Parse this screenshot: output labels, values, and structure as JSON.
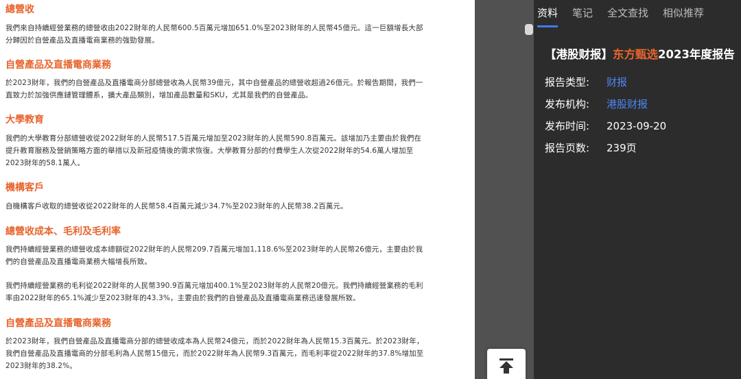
{
  "document": {
    "sections": [
      {
        "heading": "總營收",
        "paragraphs": [
          "我們來自持續經營業務的總營收由2022財年的人民幣600.5百萬元增加651.0%至2023財年的人民幣45億元。這一巨額增長大部分歸因於自營產品及直播電商業務的強勁發展。"
        ]
      },
      {
        "heading": "自營產品及直播電商業務",
        "paragraphs": [
          "於2023財年，我們的自營產品及直播電商分部總營收為人民幣39億元，其中自營產品的總營收超過26億元。於報告期間，我們一直致力於加強供應鏈管理體系，擴大產品類別，增加產品數量和SKU，尤其是我們的自營產品。"
        ]
      },
      {
        "heading": "大學教育",
        "paragraphs": [
          "我們的大學教育分部總營收從2022財年的人民幣517.5百萬元增加至2023財年的人民幣590.8百萬元。該增加乃主要由於我們在提升教育服務及營銷策略方面的舉措以及新冠疫情後的需求恢復。大學教育分部的付費學生人次從2022財年的54.6萬人增加至2023財年的58.1萬人。"
        ]
      },
      {
        "heading": "機構客戶",
        "paragraphs": [
          "自機構客戶收取的總營收從2022財年的人民幣58.4百萬元減少34.7%至2023財年的人民幣38.2百萬元。"
        ]
      },
      {
        "heading": "總營收成本、毛利及毛利率",
        "paragraphs": [
          "我們持續經營業務的總營收成本總額從2022財年的人民幣209.7百萬元增加1,118.6%至2023財年的人民幣26億元，主要由於我們的自營產品及直播電商業務大幅增長所致。",
          "我們持續經營業務的毛利從2022財年的人民幣390.9百萬元增加400.1%至2023財年的人民幣20億元。我們持續經營業務的毛利率由2022財年的65.1%減少至2023財年的43.3%，主要由於我們的自營產品及直播電商業務迅速發展所致。"
        ]
      },
      {
        "heading": "自營產品及直播電商業務",
        "paragraphs": [
          "於2023財年，我們自營產品及直播電商分部的總營收成本為人民幣24億元，而於2022財年為人民幣15.3百萬元。於2023財年，我們自營產品及直播電商的分部毛利為人民幣15億元，而於2022財年為人民幣9.3百萬元，而毛利率從2022財年的37.8%增加至2023財年的38.2%。"
        ]
      }
    ]
  },
  "tabs": [
    "资料",
    "笔记",
    "全文查找",
    "相似推荐"
  ],
  "report": {
    "title_prefix": "【港股财报】",
    "title_brand": "东方甄选",
    "title_suffix": "2023年度报告",
    "fields": [
      {
        "label": "报告类型:",
        "value": "财报"
      },
      {
        "label": "发布机构:",
        "value": "港股财报"
      },
      {
        "label": "发布时间:",
        "value": "2023-09-20"
      },
      {
        "label": "报告页数:",
        "value": "239页"
      }
    ]
  },
  "colors": {
    "heading": "#e8642c",
    "link": "#4f86f7",
    "panel_bg": "#2c2c2c",
    "gutter_bg": "#515151",
    "tab_indicator": "#3f7cf2"
  },
  "icons": {
    "back_to_top": "arrow-to-top-icon"
  }
}
